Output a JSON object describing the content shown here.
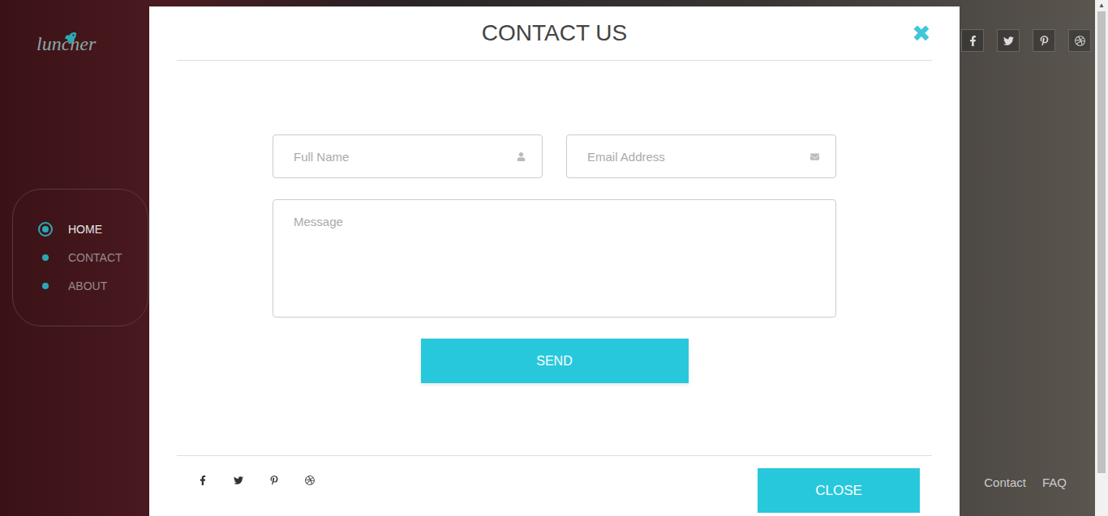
{
  "logo": "luncher",
  "nav": [
    {
      "label": "HOME",
      "selected": true
    },
    {
      "label": "CONTACT",
      "selected": false
    },
    {
      "label": "ABOUT",
      "selected": false
    }
  ],
  "footer_links": [
    "Contact",
    "FAQ"
  ],
  "modal": {
    "title": "CONTACT US",
    "close_icon": "✖",
    "fields": [
      {
        "placeholder": "Full Name",
        "kind": "name"
      },
      {
        "placeholder": "Email Address",
        "kind": "email"
      }
    ],
    "message": {
      "placeholder": "Message"
    },
    "send": "SEND",
    "close": "CLOSE"
  }
}
